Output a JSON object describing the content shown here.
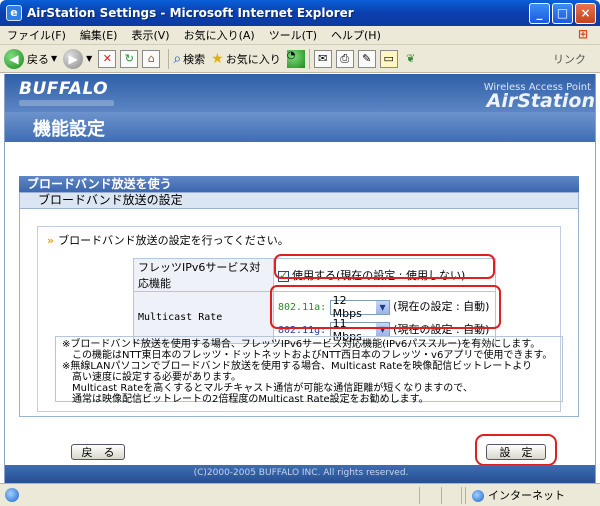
{
  "window": {
    "title": "AirStation Settings - Microsoft Internet Explorer",
    "min_label": "_",
    "max_label": "□",
    "close_label": "×"
  },
  "menu": [
    "ファイル(F)",
    "編集(E)",
    "表示(V)",
    "お気に入り(A)",
    "ツール(T)",
    "ヘルプ(H)"
  ],
  "toolbar": {
    "back_label": "戻る",
    "search_label": "検索",
    "favorites_label": "お気に入り",
    "links_label": "リンク"
  },
  "header": {
    "brand": "BUFFALO",
    "wap_label": "Wireless Access Point",
    "product": "AirStation",
    "page_title": "機能設定"
  },
  "section": {
    "title": "ブロードバンド放送を使う",
    "subtitle": "ブロードバンド放送の設定"
  },
  "instruction": "ブロードバンド放送の設定を行ってください。",
  "settings": {
    "ipv6_label": "フレッツIPv6サービス対応機能",
    "ipv6_checkbox_label": "使用する(現在の設定 : 使用しない)",
    "ipv6_checked": true,
    "multicast_label": "Multicast Rate",
    "rate_11a_label": "802.11a:",
    "rate_11a_value": "12 Mbps",
    "rate_11a_current": "(現在の設定 : 自動)",
    "rate_11g_label": "802.11g:",
    "rate_11g_value": "11 Mbps",
    "rate_11g_current": "(現在の設定 : 自動)"
  },
  "notes": [
    "※ブロードバンド放送を使用する場合、フレッツIPv6サービス対応機能(IPv6パススルー)を有効にします。",
    "　この機能はNTT東日本のフレッツ・ドットネットおよびNTT西日本のフレッツ・v6アプリで使用できます。",
    "※無線LANパソコンでブロードバンド放送を使用する場合、Multicast Rateを映像配信ビットレートより",
    "　高い速度に設定する必要があります。",
    "　Multicast Rateを高くするとマルチキャスト通信が可能な通信距離が短くなりますので、",
    "　通常は映像配信ビットレートの2倍程度のMulticast Rate設定をお勧めします。"
  ],
  "buttons": {
    "back": "戻　る",
    "submit": "設　定"
  },
  "footer": "(C)2000-2005 BUFFALO INC. All rights reserved.",
  "status": {
    "zone": "インターネット"
  },
  "colors": {
    "highlight": "#e02020",
    "header": "#3e6db4"
  }
}
